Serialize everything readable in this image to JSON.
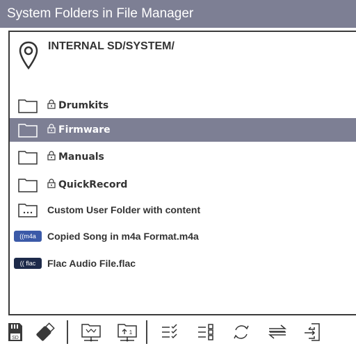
{
  "window": {
    "title": "System Folders in File Manager"
  },
  "location": {
    "path": "INTERNAL SD/SYSTEM/",
    "icon": "map-pin-icon"
  },
  "rows": [
    {
      "label": "Drumkits",
      "type": "folder",
      "locked": true,
      "selected": false
    },
    {
      "label": "Firmware",
      "type": "folder",
      "locked": true,
      "selected": true
    },
    {
      "label": "Manuals",
      "type": "folder",
      "locked": true,
      "selected": false
    },
    {
      "label": "QuickRecord",
      "type": "folder",
      "locked": true,
      "selected": false
    },
    {
      "label": "Custom User Folder with content",
      "type": "folder-content",
      "locked": false,
      "selected": false
    },
    {
      "label": "Copied Song in m4a Format.m4a",
      "type": "m4a",
      "badge": "((m4a",
      "locked": false,
      "selected": false
    },
    {
      "label": "Flac Audio File.flac",
      "type": "flac",
      "badge": "(( flac",
      "locked": false,
      "selected": false
    }
  ],
  "toolbar": {
    "sd_label": "SD",
    "copy_badge": "1",
    "buttons": [
      "sd-card-icon",
      "usb-drive-icon",
      "folder-tree-icon",
      "upload-folder-icon",
      "checklist-icon",
      "list-view-icon",
      "refresh-icon",
      "swap-icon",
      "export-icon"
    ]
  },
  "colors": {
    "titlebar": "#7d7f94",
    "selected": "#7d7f94",
    "m4a_badge": "#3b5aa8",
    "flac_badge": "#1d2a4a",
    "text": "#333333"
  }
}
